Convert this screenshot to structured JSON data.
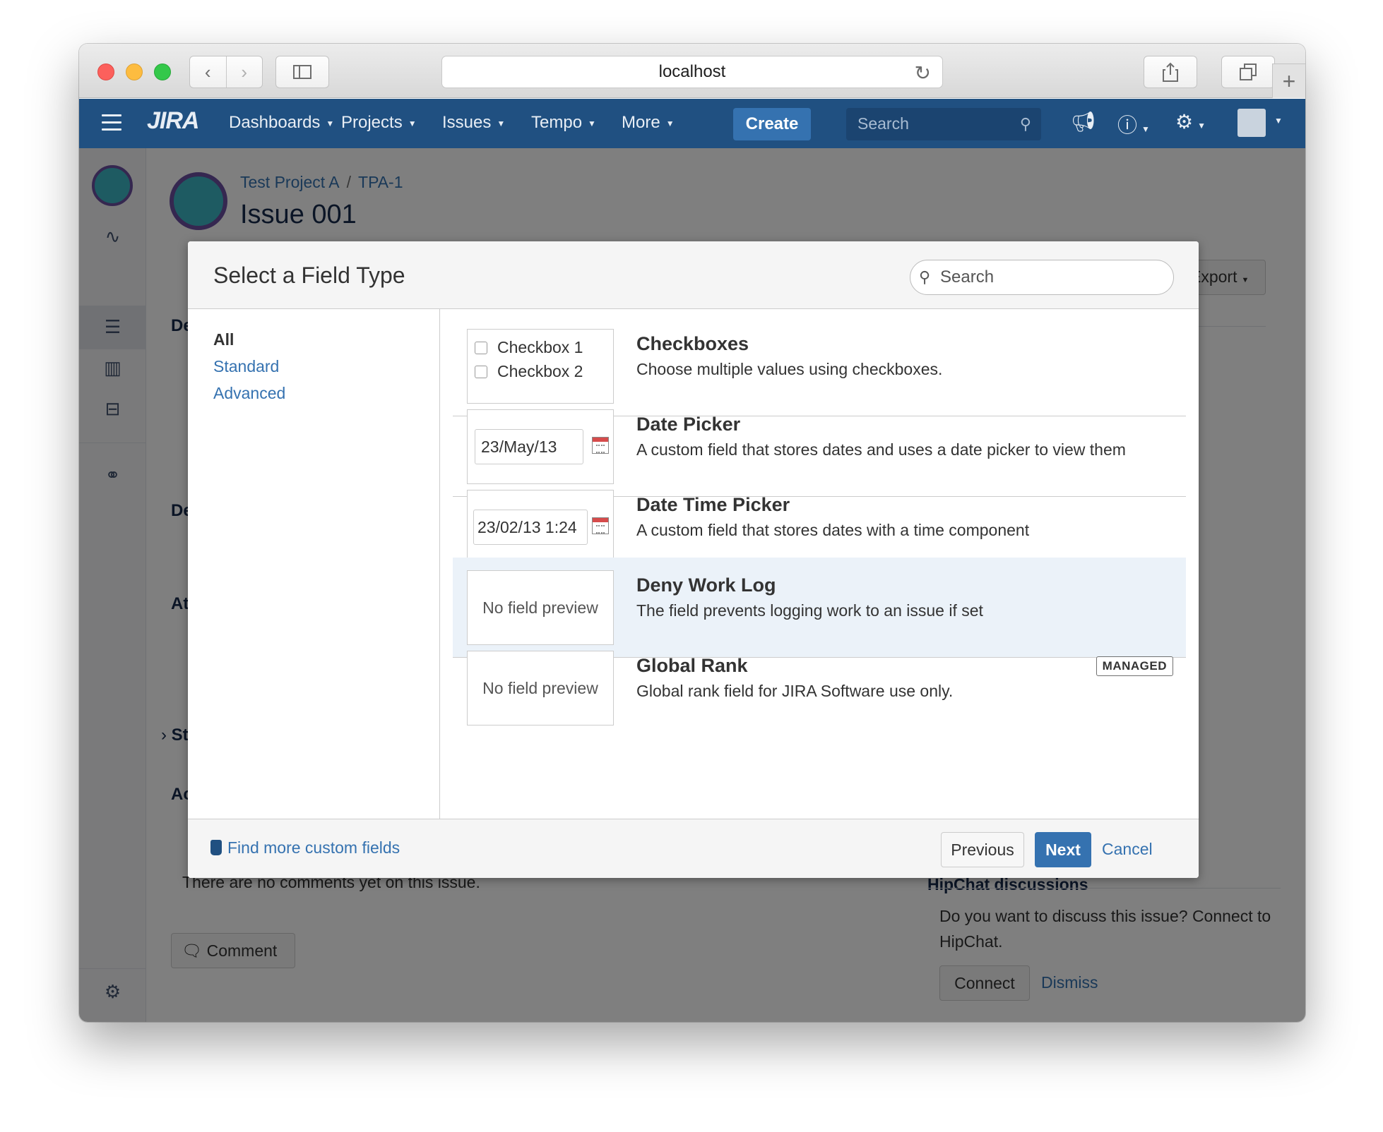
{
  "browser": {
    "address": "localhost"
  },
  "header": {
    "logo": "JIRA",
    "nav": [
      {
        "label": "Dashboards"
      },
      {
        "label": "Projects"
      },
      {
        "label": "Issues"
      },
      {
        "label": "Tempo"
      },
      {
        "label": "More"
      }
    ],
    "create_label": "Create",
    "search_placeholder": "Search"
  },
  "issue": {
    "project": "Test Project A",
    "key": "TPA-1",
    "title": "Issue 001",
    "export_label": "Export",
    "no_comments": "There are no comments yet on this issue.",
    "comment_label": "Comment",
    "fragments": [
      "De",
      "De",
      "At",
      "St",
      "Ac"
    ]
  },
  "hipchat": {
    "title": "HipChat discussions",
    "text": "Do you want to discuss this issue? Connect to HipChat.",
    "connect_label": "Connect",
    "dismiss_label": "Dismiss"
  },
  "dialog": {
    "title": "Select a Field Type",
    "search_placeholder": "Search",
    "categories": [
      {
        "label": "All",
        "active": true
      },
      {
        "label": "Standard",
        "active": false
      },
      {
        "label": "Advanced",
        "active": false
      }
    ],
    "field_types": [
      {
        "name": "Checkboxes",
        "description": "Choose multiple values using checkboxes.",
        "preview": {
          "kind": "checkboxes",
          "options": [
            "Checkbox 1",
            "Checkbox 2"
          ]
        }
      },
      {
        "name": "Date Picker",
        "description": "A custom field that stores dates and uses a date picker to view them",
        "preview": {
          "kind": "date",
          "value": "23/May/13"
        }
      },
      {
        "name": "Date Time Picker",
        "description": "A custom field that stores dates with a time component",
        "preview": {
          "kind": "datetime",
          "value": "23/02/13 1:24"
        }
      },
      {
        "name": "Deny Work Log",
        "description": "The field prevents logging work to an issue if set",
        "preview": {
          "kind": "none",
          "text": "No field preview"
        },
        "selected": true
      },
      {
        "name": "Global Rank",
        "description": "Global rank field for JIRA Software use only.",
        "preview": {
          "kind": "none",
          "text": "No field preview"
        },
        "badge": "MANAGED"
      }
    ],
    "footer": {
      "find_more": "Find more custom fields",
      "previous_label": "Previous",
      "next_label": "Next",
      "cancel_label": "Cancel"
    }
  },
  "colors": {
    "header_bg": "#205081",
    "primary": "#3572b0",
    "selected_row": "#ebf2f9"
  }
}
